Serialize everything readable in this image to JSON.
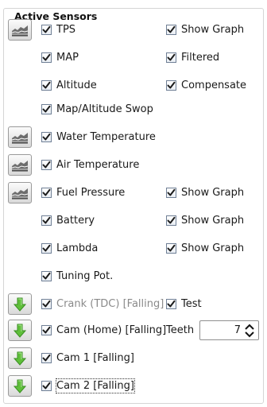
{
  "panel": {
    "title": "Active Sensors"
  },
  "sensors": [
    {
      "id": "tps",
      "label": "TPS",
      "button": "graph",
      "checked": true,
      "option": {
        "label": "Show Graph",
        "checked": true
      }
    },
    {
      "id": "map",
      "label": "MAP",
      "checked": true,
      "option": {
        "label": "Filtered",
        "checked": true
      }
    },
    {
      "id": "altitude",
      "label": "Altitude",
      "checked": true,
      "option": {
        "label": "Compensate",
        "checked": true
      }
    },
    {
      "id": "map-altitude-swop",
      "label": "Map/Altitude Swop",
      "checked": true
    },
    {
      "id": "water-temperature",
      "label": "Water Temperature",
      "button": "graph",
      "checked": true
    },
    {
      "id": "air-temperature",
      "label": "Air Temperature",
      "button": "graph",
      "checked": true
    },
    {
      "id": "fuel-pressure",
      "label": "Fuel Pressure",
      "button": "graph",
      "checked": true,
      "option": {
        "label": "Show Graph",
        "checked": true
      }
    },
    {
      "id": "battery",
      "label": "Battery",
      "checked": true,
      "option": {
        "label": "Show Graph",
        "checked": true
      }
    },
    {
      "id": "lambda",
      "label": "Lambda",
      "checked": true,
      "option": {
        "label": "Show Graph",
        "checked": true
      }
    },
    {
      "id": "tuning-pot",
      "label": "Tuning Pot.",
      "checked": true
    },
    {
      "id": "crank",
      "label": "Crank (TDC) [Falling]",
      "button": "arrow",
      "checked": true,
      "disabled": true,
      "option": {
        "label": "Test",
        "checked": true
      }
    },
    {
      "id": "cam-home",
      "label": "Cam (Home) [Falling]",
      "button": "arrow",
      "checked": true,
      "teeth": {
        "label": "Teeth",
        "value": "7"
      }
    },
    {
      "id": "cam-1",
      "label": "Cam 1 [Falling]",
      "button": "arrow",
      "checked": true
    },
    {
      "id": "cam-2",
      "label": "Cam 2 [Falling]",
      "button": "arrow",
      "checked": true,
      "focused": true
    }
  ],
  "icons": {
    "graph": "graph-icon",
    "arrow": "green-down-arrow-icon",
    "check_color": "#1b1b1b",
    "arrow_color": "#5fbf3a"
  }
}
